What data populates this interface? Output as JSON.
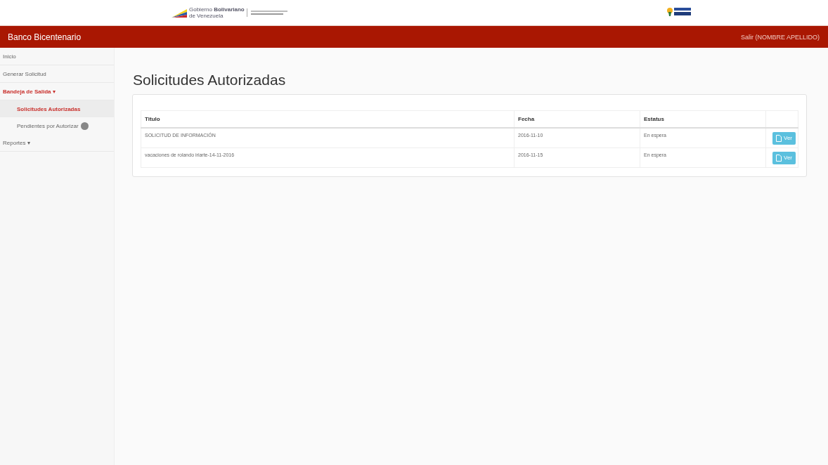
{
  "header": {
    "logo_text": {
      "line1": "Gobierno **Bolivariano**",
      "line2": "de Venezuela"
    }
  },
  "navbar": {
    "brand": "Banco Bicentenario",
    "user_link": "Salir (NOMBRE APELLIDO)"
  },
  "sidebar": {
    "items": [
      {
        "label": "Inicio",
        "selected": false,
        "kind": "link"
      },
      {
        "label": "Generar Solicitud",
        "selected": false,
        "kind": "link"
      },
      {
        "label": "Bandeja de Salida",
        "selected": true,
        "kind": "dropdown",
        "caret": "▾",
        "children": [
          {
            "label": "Solicitudes Autorizadas",
            "selected": true,
            "kind": "link"
          },
          {
            "label": "Pendientes por Autorizar",
            "selected": false,
            "kind": "badge"
          }
        ]
      },
      {
        "label": "Reportes",
        "selected": false,
        "kind": "dropdown",
        "caret": "▾"
      }
    ]
  },
  "page": {
    "title": "Solicitudes Autorizadas"
  },
  "table": {
    "columns": [
      "Titulo",
      "Fecha",
      "Estatus"
    ],
    "rows": [
      {
        "title": "SOLICITUD DE INFORMACIÓN",
        "date": "2016-11-10",
        "status": "En espera",
        "action": "Ver"
      },
      {
        "title": "vacaciones de rolando iriarte-14-11-2016",
        "date": "2016-11-15",
        "status": "En espera",
        "action": "Ver"
      }
    ]
  }
}
